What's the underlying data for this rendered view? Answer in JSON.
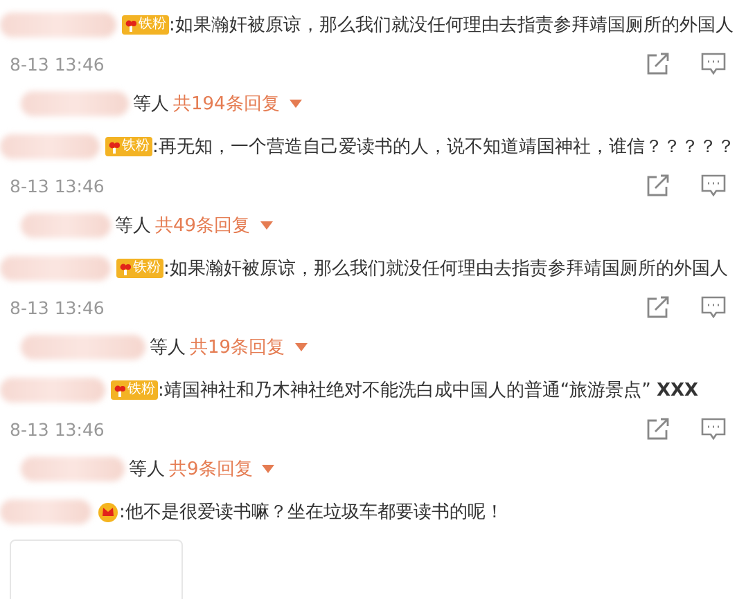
{
  "comments": [
    {
      "badge": {
        "kind": "fan",
        "label": "铁粉"
      },
      "text": ":如果瀚奸被原谅，那么我们就没任何理由去指责参拜靖国厕所的外国人",
      "time": "8-13 13:46",
      "reply_summary": {
        "suffix": "等人",
        "count": "共194条回复"
      }
    },
    {
      "badge": {
        "kind": "fan",
        "label": "铁粉"
      },
      "text": ":再无知，一个营造自己爱读书的人，说不知道靖国神社，谁信？？？？？",
      "time": "8-13 13:46",
      "reply_summary": {
        "suffix": "等人",
        "count": "共49条回复"
      }
    },
    {
      "badge": {
        "kind": "fan",
        "label": "铁粉"
      },
      "text": ":如果瀚奸被原谅，那么我们就没任何理由去指责参拜靖国厕所的外国人",
      "time": "8-13 13:46",
      "reply_summary": {
        "suffix": "等人",
        "count": "共19条回复"
      }
    },
    {
      "badge": {
        "kind": "fan",
        "label": "铁粉"
      },
      "text": ":靖国神社和乃木神社绝对不能洗白成中国人的普通“旅游景点” **XXX**",
      "time": "8-13 13:46",
      "reply_summary": {
        "suffix": "等人",
        "count": "共9条回复"
      }
    },
    {
      "badge": {
        "kind": "crown"
      },
      "text": ":他不是很爱读书嘛？坐在垃圾车都要读书的呢！",
      "attachment": {
        "kind": "image"
      }
    }
  ]
}
